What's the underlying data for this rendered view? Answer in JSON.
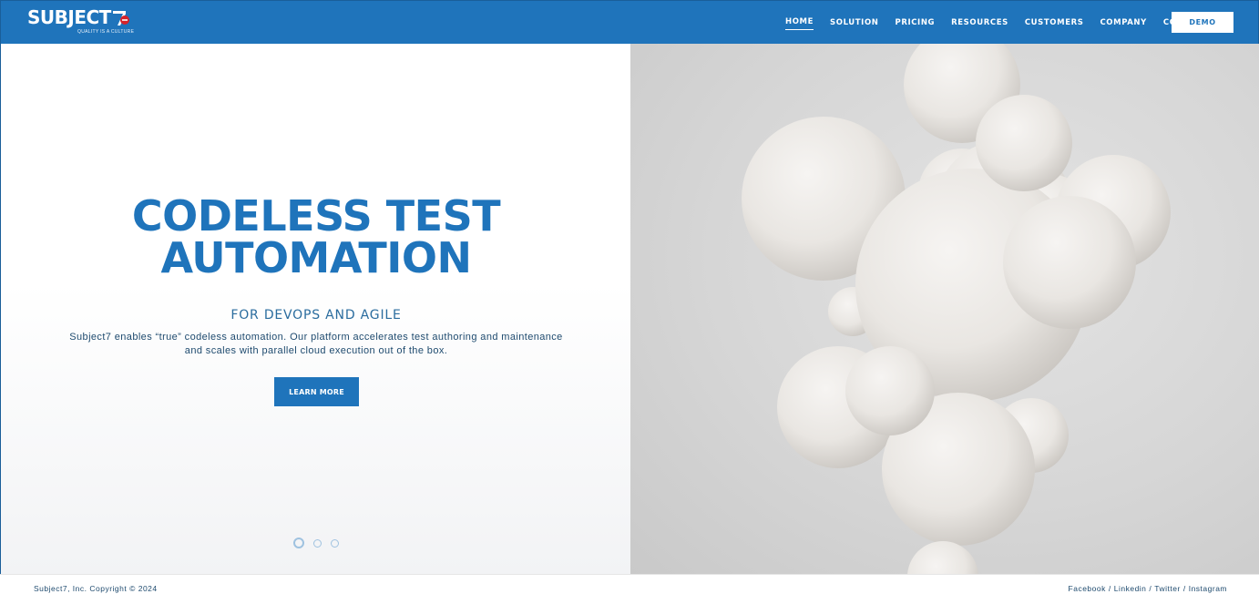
{
  "header": {
    "logo_text": "SUBJECT",
    "logo_tagline": "QUALITY IS A CULTURE",
    "nav": [
      {
        "label": "HOME",
        "active": true
      },
      {
        "label": "SOLUTION",
        "active": false
      },
      {
        "label": "PRICING",
        "active": false
      },
      {
        "label": "RESOURCES",
        "active": false
      },
      {
        "label": "CUSTOMERS",
        "active": false
      },
      {
        "label": "COMPANY",
        "active": false
      },
      {
        "label": "CONTACT",
        "active": false
      }
    ],
    "demo_label": "DEMO"
  },
  "hero": {
    "title_line1": "CODELESS TEST",
    "title_line2": "AUTOMATION",
    "subtitle": "FOR DEVOPS AND AGILE",
    "description_line1": "Subject7 enables “true” codeless automation. Our platform accelerates test authoring and maintenance",
    "description_line2": "and scales with parallel cloud execution out of the box.",
    "cta_label": "LEARN MORE",
    "slide_count": 3,
    "active_slide": 1
  },
  "footer": {
    "copyright": "Subject7, Inc. Copyright © 2024",
    "social": [
      "Facebook",
      "Linkedin",
      "Twitter",
      "Instagram"
    ],
    "separator": "/"
  },
  "colors": {
    "brand_blue": "#1f74bb",
    "logo_accent_red": "#d6232a",
    "text_dark_blue": "#1e4a6e",
    "image_bg": "#d9d9d9",
    "sphere": "#ece9e6"
  }
}
